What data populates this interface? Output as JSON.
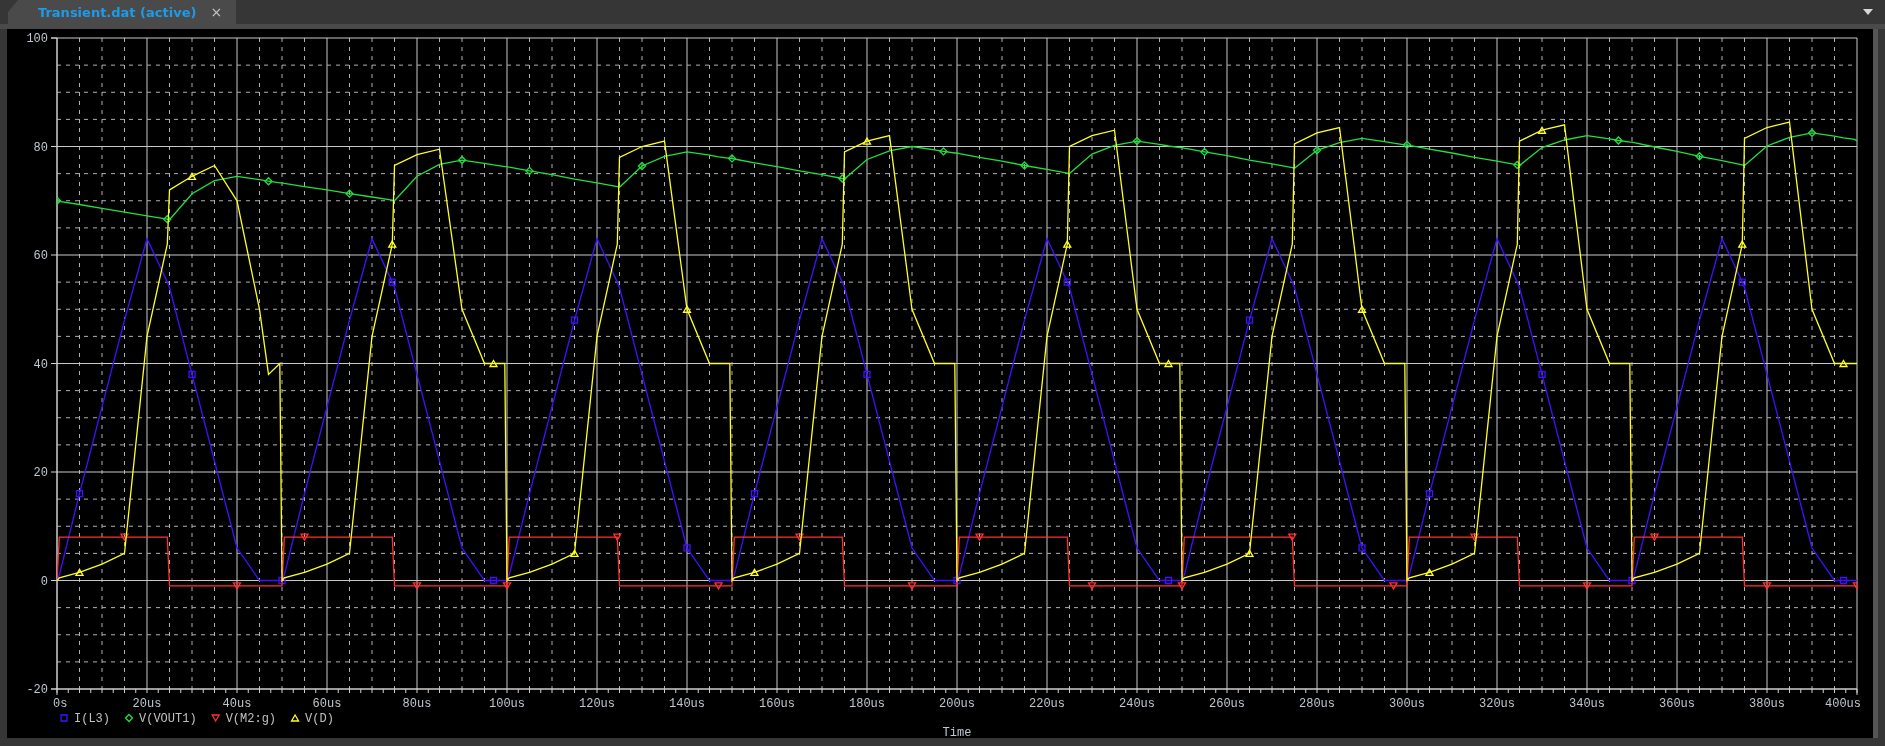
{
  "tabs": [
    {
      "label": "Transient.dat (active)",
      "selected": true,
      "close": "×"
    }
  ],
  "plot": {
    "chart_data": {
      "type": "line",
      "xlabel": "Time",
      "xlim": [
        0,
        400
      ],
      "ylim": [
        -20,
        100
      ],
      "xticks": [
        {
          "value": 0,
          "label": "0s"
        },
        {
          "value": 20,
          "label": "20us"
        },
        {
          "value": 40,
          "label": "40us"
        },
        {
          "value": 60,
          "label": "60us"
        },
        {
          "value": 80,
          "label": "80us"
        },
        {
          "value": 100,
          "label": "100us"
        },
        {
          "value": 120,
          "label": "120us"
        },
        {
          "value": 140,
          "label": "140us"
        },
        {
          "value": 160,
          "label": "160us"
        },
        {
          "value": 180,
          "label": "180us"
        },
        {
          "value": 200,
          "label": "200us"
        },
        {
          "value": 220,
          "label": "220us"
        },
        {
          "value": 240,
          "label": "240us"
        },
        {
          "value": 260,
          "label": "260us"
        },
        {
          "value": 280,
          "label": "280us"
        },
        {
          "value": 300,
          "label": "300us"
        },
        {
          "value": 320,
          "label": "320us"
        },
        {
          "value": 340,
          "label": "340us"
        },
        {
          "value": 360,
          "label": "360us"
        },
        {
          "value": 380,
          "label": "380us"
        },
        {
          "value": 400,
          "label": "400us"
        }
      ],
      "yticks": [
        -20,
        0,
        20,
        40,
        60,
        80,
        100
      ],
      "grid": true,
      "legend": "bottom",
      "x": [
        0,
        0.5,
        5,
        10,
        15,
        20,
        24.5,
        25,
        30,
        35,
        40,
        45,
        47,
        49.5,
        50,
        50.5,
        55,
        60,
        65,
        70,
        74.5,
        75,
        80,
        85,
        90,
        95,
        97,
        99.5,
        100,
        100.5,
        105,
        110,
        115,
        120,
        124.5,
        125,
        130,
        135,
        140,
        145,
        147,
        149.5,
        150,
        150.5,
        155,
        160,
        165,
        170,
        174.5,
        175,
        180,
        185,
        190,
        195,
        197,
        199.5,
        200,
        200.5,
        205,
        210,
        215,
        220,
        224.5,
        225,
        230,
        235,
        240,
        245,
        247,
        249.5,
        250,
        250.5,
        255,
        260,
        265,
        270,
        274.5,
        275,
        280,
        285,
        290,
        295,
        297,
        299.5,
        300,
        300.5,
        305,
        310,
        315,
        320,
        324.5,
        325,
        330,
        335,
        340,
        345,
        347,
        349.5,
        350,
        350.5,
        355,
        360,
        365,
        370,
        374.5,
        375,
        380,
        385,
        390,
        395,
        397,
        399.5,
        400
      ],
      "series": [
        {
          "name": "I(L3)",
          "color": "#4010ff",
          "values": [
            0,
            1,
            16,
            32,
            48,
            63,
            55,
            54,
            38,
            22,
            6,
            0,
            0,
            0,
            0,
            1,
            16,
            32,
            48,
            63,
            55,
            54,
            38,
            22,
            6,
            0,
            0,
            0,
            0,
            1,
            16,
            32,
            48,
            63,
            55,
            54,
            38,
            22,
            6,
            0,
            0,
            0,
            0,
            1,
            16,
            32,
            48,
            63,
            55,
            54,
            38,
            22,
            6,
            0,
            0,
            0,
            0,
            1,
            16,
            32,
            48,
            63,
            55,
            54,
            38,
            22,
            6,
            0,
            0,
            0,
            0,
            1,
            16,
            32,
            48,
            63,
            55,
            54,
            38,
            22,
            6,
            0,
            0,
            0,
            0,
            1,
            16,
            32,
            48,
            63,
            55,
            54,
            38,
            22,
            6,
            0,
            0,
            0,
            0,
            1,
            16,
            32,
            48,
            63,
            55,
            54,
            38,
            22,
            6,
            0,
            0,
            0,
            0
          ]
        },
        {
          "name": "V(VOUT1)",
          "color": "#20e040",
          "values": [
            70,
            69.9,
            69.3,
            68.6,
            67.9,
            67.2,
            66.6,
            66.5,
            71.3,
            73.7,
            74.5,
            73.9,
            73.6,
            73.3,
            73.3,
            73.2,
            72.6,
            72,
            71.3,
            70.7,
            70.1,
            70,
            74.5,
            76.7,
            77.5,
            76.9,
            76.6,
            76.3,
            76.3,
            76.2,
            75.5,
            74.8,
            74,
            73.3,
            72.6,
            72.5,
            76.4,
            78.2,
            79,
            78.4,
            78.1,
            77.8,
            77.8,
            77.7,
            77,
            76.3,
            75.5,
            74.8,
            74.1,
            74,
            77.6,
            79.2,
            80,
            79.4,
            79.1,
            78.8,
            78.8,
            78.7,
            78,
            77.3,
            76.5,
            75.8,
            75.1,
            75,
            78.6,
            80.2,
            81,
            80.4,
            80.1,
            79.8,
            79.8,
            79.7,
            79,
            78.3,
            77.5,
            76.8,
            76.1,
            76,
            79.3,
            80.7,
            81.5,
            80.9,
            80.6,
            80.3,
            80.3,
            80.2,
            79.5,
            78.8,
            78,
            77.3,
            76.6,
            76.5,
            79.8,
            81.2,
            82,
            81.4,
            81.1,
            80.8,
            80.8,
            80.7,
            79.9,
            79.1,
            78.2,
            77.4,
            76.6,
            76.5,
            80.1,
            81.7,
            82.5,
            81.9,
            81.6,
            81.3,
            81
          ]
        },
        {
          "name": "V(M2:g)",
          "color": "#ff3030",
          "values": [
            0,
            8,
            8,
            8,
            8,
            8,
            8,
            -1,
            -1,
            -1,
            -1,
            -1,
            -1,
            -1,
            -1,
            8,
            8,
            8,
            8,
            8,
            8,
            -1,
            -1,
            -1,
            -1,
            -1,
            -1,
            -1,
            -1,
            8,
            8,
            8,
            8,
            8,
            8,
            -1,
            -1,
            -1,
            -1,
            -1,
            -1,
            -1,
            -1,
            8,
            8,
            8,
            8,
            8,
            8,
            -1,
            -1,
            -1,
            -1,
            -1,
            -1,
            -1,
            -1,
            8,
            8,
            8,
            8,
            8,
            8,
            -1,
            -1,
            -1,
            -1,
            -1,
            -1,
            -1,
            -1,
            8,
            8,
            8,
            8,
            8,
            8,
            -1,
            -1,
            -1,
            -1,
            -1,
            -1,
            -1,
            -1,
            8,
            8,
            8,
            8,
            8,
            8,
            -1,
            -1,
            -1,
            -1,
            -1,
            -1,
            -1,
            -1,
            8,
            8,
            8,
            8,
            8,
            8,
            -1,
            -1,
            -1,
            -1,
            -1,
            -1,
            -1,
            -1
          ]
        },
        {
          "name": "V(D)",
          "color": "#ffff20",
          "values": [
            0,
            0.5,
            1.5,
            3,
            5,
            45,
            62,
            72,
            74.5,
            76.5,
            70,
            50,
            38,
            40,
            0,
            0.5,
            1.5,
            3,
            5,
            45,
            62,
            76.5,
            78.5,
            79.5,
            50,
            40,
            40,
            40,
            0,
            0.5,
            1.5,
            3,
            5,
            45,
            62,
            78,
            80,
            81,
            50,
            40,
            40,
            40,
            0,
            0.5,
            1.5,
            3,
            5,
            45,
            62,
            79,
            81,
            82,
            50,
            40,
            40,
            40,
            0,
            0.5,
            1.5,
            3,
            5,
            45,
            62,
            80,
            82,
            83,
            50,
            40,
            40,
            40,
            0,
            0.5,
            1.5,
            3,
            5,
            45,
            62,
            80.5,
            82.5,
            83.5,
            50,
            40,
            40,
            40,
            0,
            0.5,
            1.5,
            3,
            5,
            45,
            62,
            81,
            83,
            84,
            50,
            40,
            40,
            40,
            0,
            0.5,
            1.5,
            3,
            5,
            45,
            62,
            81.5,
            83.5,
            84.5,
            50,
            40,
            40,
            40,
            40
          ]
        }
      ]
    }
  }
}
